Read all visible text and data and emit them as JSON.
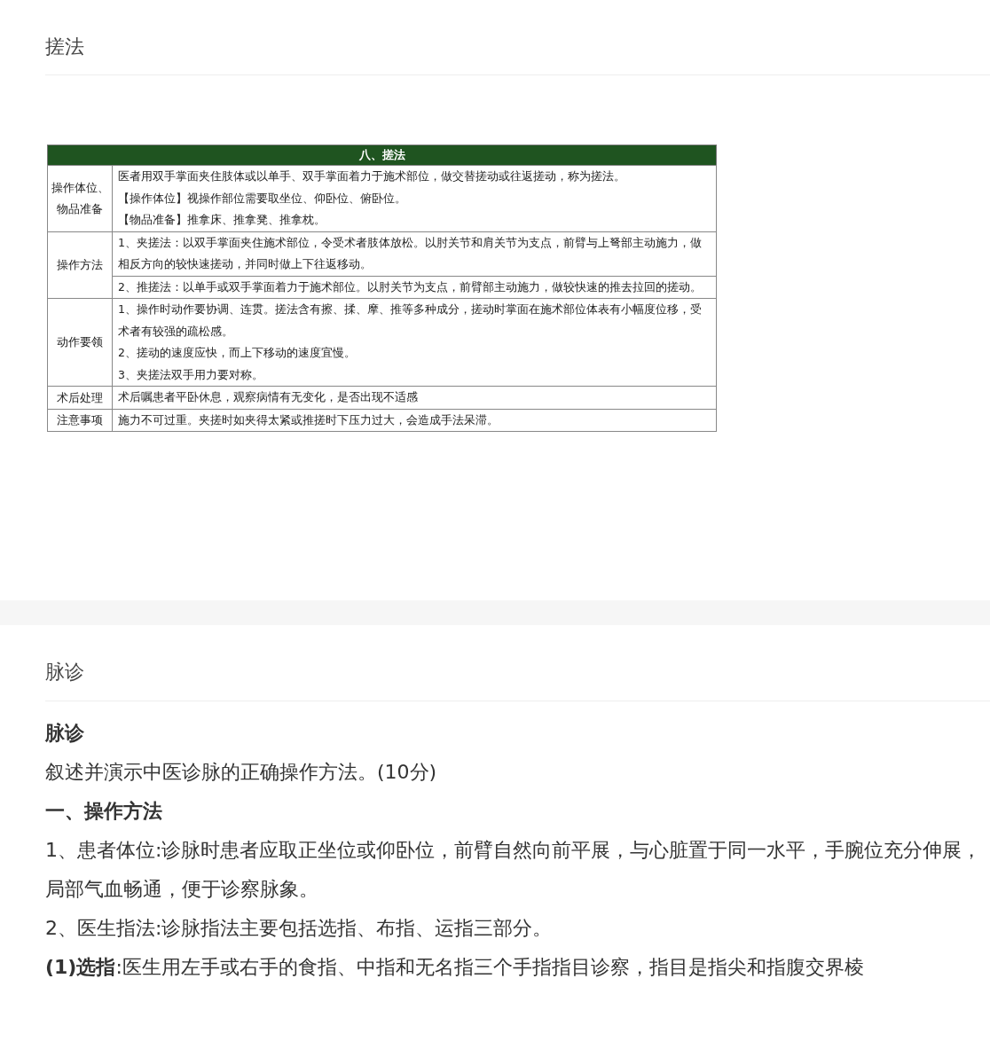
{
  "sections": [
    {
      "title": "搓法",
      "table": {
        "title": "八、搓法",
        "rows": [
          {
            "label": "操作体位、物品准备",
            "cells": [
              {
                "paragraphs": [
                  "医者用双手掌面夹住肢体或以单手、双手掌面着力于施术部位，做交替搓动或往返搓动，称为搓法。",
                  "【操作体位】视操作部位需要取坐位、仰卧位、俯卧位。",
                  "【物品准备】推拿床、推拿凳、推拿枕。"
                ]
              }
            ]
          },
          {
            "label": "操作方法",
            "cells": [
              {
                "paragraphs": [
                  "1、夹搓法：以双手掌面夹住施术部位，令受术者肢体放松。以肘关节和肩关节为支点，前臂与上弩部主动施力，做相反方向的较快速搓动，并同时做上下往返移动。"
                ]
              },
              {
                "paragraphs": [
                  "2、推搓法：以单手或双手掌面着力于施术部位。以肘关节为支点，前臂部主动施力，做较快速的推去拉回的搓动。"
                ]
              }
            ]
          },
          {
            "label": "动作要领",
            "cells": [
              {
                "paragraphs": [
                  "1、操作时动作要协调、连贯。搓法含有擦、揉、摩、推等多种成分，搓动时掌面在施术部位体表有小幅度位移，受术者有较强的疏松感。",
                  "2、搓动的速度应快，而上下移动的速度宜慢。",
                  "3、夹搓法双手用力要对称。"
                ]
              }
            ]
          },
          {
            "label": "术后处理",
            "cells": [
              {
                "paragraphs": [
                  "术后嘱患者平卧休息，观察病情有无变化，是否出现不适感"
                ]
              }
            ]
          },
          {
            "label": "注意事项",
            "cells": [
              {
                "paragraphs": [
                  "施力不可过重。夹搓时如夹得太紧或推搓时下压力过大，会造成手法呆滞。"
                ]
              }
            ]
          }
        ]
      }
    },
    {
      "title": "脉诊",
      "body": [
        {
          "kind": "heading",
          "text": "脉诊"
        },
        {
          "kind": "text",
          "text": "叙述并演示中医诊脉的正确操作方法。(10分)"
        },
        {
          "kind": "heading",
          "text": "一、操作方法"
        },
        {
          "kind": "text",
          "text": "1、患者体位:诊脉时患者应取正坐位或仰卧位，前臂自然向前平展，与心脏置于同一水平，手腕位充分伸展，局部气血畅通，便于诊察脉象。"
        },
        {
          "kind": "text",
          "text": "2、医生指法:诊脉指法主要包括选指、布指、运指三部分。"
        },
        {
          "kind": "text",
          "text": "**(1)选指**:医生用左手或右手的食指、中指和无名指三个手指指目诊察，指目是指尖和指腹交界棱"
        }
      ]
    }
  ]
}
